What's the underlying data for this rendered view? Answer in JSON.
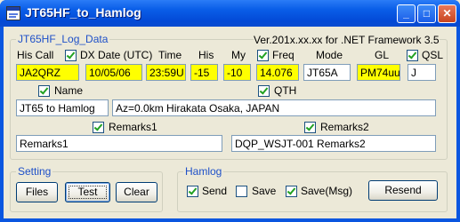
{
  "window": {
    "title": "JT65HF_to_Hamlog"
  },
  "log_group": {
    "label": "JT65HF_Log_Data",
    "version_text": "Ver.201x.xx.xx for .NET Framework 3.5",
    "headers": {
      "his_call": "His Call",
      "dx": "DX",
      "date_utc": "Date (UTC)",
      "time": "Time",
      "his": "His",
      "my": "My",
      "freq": "Freq",
      "mode": "Mode",
      "gl": "GL",
      "qsl": "QSL"
    },
    "values": {
      "his_call": "JA2QRZ",
      "date": "10/05/06",
      "time": "23:59U",
      "his": "-15",
      "my": "-10",
      "freq": "14.076",
      "mode": "JT65A",
      "gl": "PM74uu",
      "qsl": "J"
    },
    "dx_checked": true,
    "freq_checked": true,
    "qsl_checked": true,
    "name_label": "Name",
    "name_checked": true,
    "name_value": "JT65 to Hamlog",
    "qth_label": "QTH",
    "qth_checked": true,
    "qth_value": "Az=0.0km Hirakata Osaka, JAPAN",
    "remarks1_label": "Remarks1",
    "remarks1_checked": true,
    "remarks1_value": "Remarks1",
    "remarks2_label": "Remarks2",
    "remarks2_checked": true,
    "remarks2_value": "DQP_WSJT-001 Remarks2"
  },
  "setting_group": {
    "label": "Setting",
    "files_label": "Files",
    "test_label": "Test",
    "clear_label": "Clear"
  },
  "hamlog_group": {
    "label": "Hamlog",
    "send_label": "Send",
    "send_checked": true,
    "save_label": "Save",
    "save_checked": false,
    "save_msg_label": "Save(Msg)",
    "save_msg_checked": true,
    "resend_label": "Resend"
  }
}
